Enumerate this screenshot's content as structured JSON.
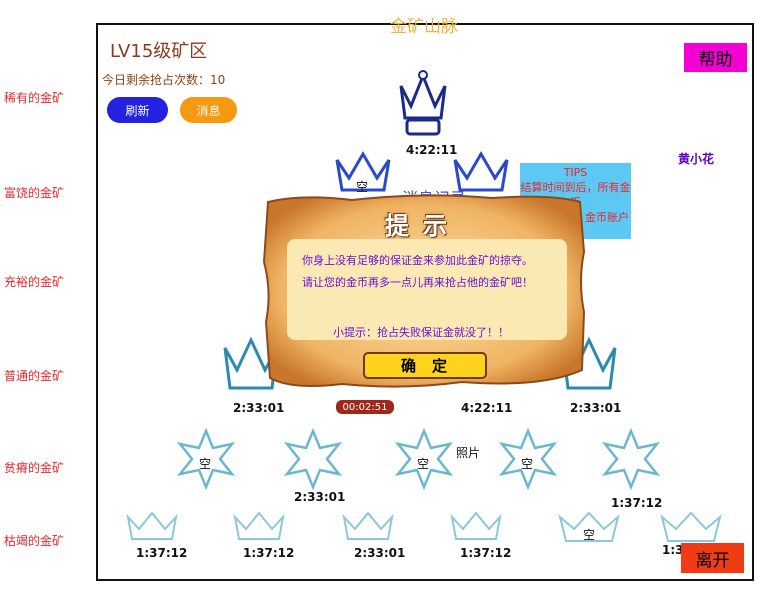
{
  "page": {
    "title": "金矿山脉",
    "zone": "LV15级矿区",
    "remaining": "今日剩余抢占次数：10"
  },
  "buttons": {
    "refresh": "刷新",
    "messages": "消息",
    "help": "帮助",
    "leave": "离开"
  },
  "sidebar": {
    "levels": [
      "稀有的金矿",
      "富饶的金矿",
      "充裕的金矿",
      "普通的金矿",
      "贫瘠的金矿",
      "枯竭的金矿"
    ]
  },
  "top_time": "4:22:11",
  "row2": {
    "empty": "空",
    "log_label": "消息记录"
  },
  "tips": {
    "title": "TIPS",
    "line1": "结算时间到后，所有金币",
    "line2": "金币账户"
  },
  "owner_name": "黄小花",
  "dialog": {
    "title": "提示",
    "line1": "你身上没有足够的保证金来参加此金矿的掠夺。",
    "line2": "请让您的金币再多一点儿再来抢占他的金矿吧！",
    "hint": "小提示：抢占失败保证金就没了！！",
    "ok": "确定"
  },
  "row4": {
    "times": [
      "2:33:01",
      "4:22:11",
      "2:33:01"
    ],
    "countdown": "00:02:51"
  },
  "row5": {
    "empty": "空",
    "photo": "照片",
    "times": [
      "2:33:01",
      "1:37:12"
    ]
  },
  "row6": {
    "empty": "空",
    "times": [
      "1:37:12",
      "1:37:12",
      "2:33:01",
      "1:37:12",
      "1:3"
    ]
  },
  "colors": {
    "accent": "#f0b43a",
    "help": "#f200d4",
    "leave": "#f03c14",
    "refresh": "#2222e0",
    "messages": "#f59a10"
  }
}
